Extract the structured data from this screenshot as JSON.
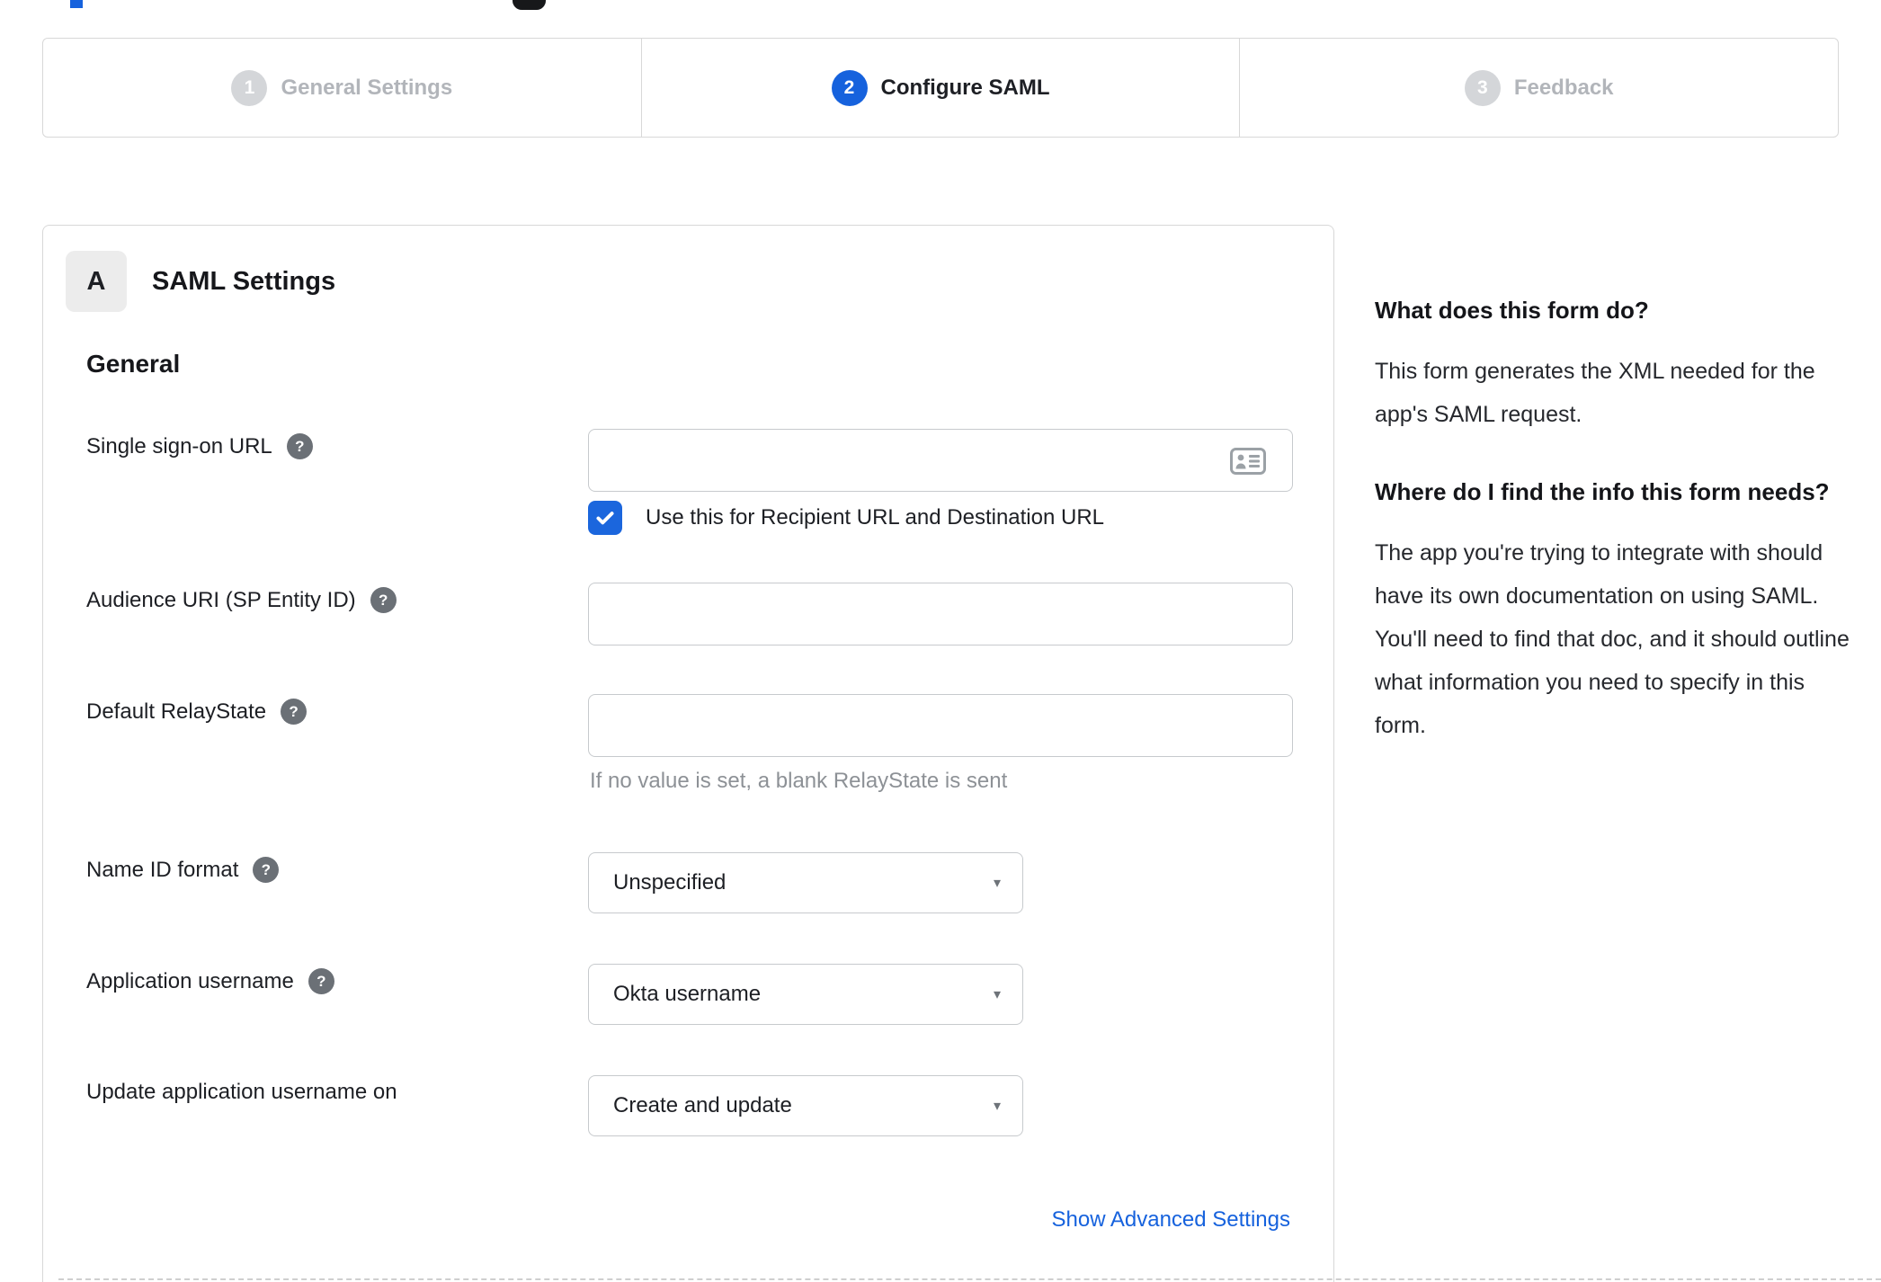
{
  "colors": {
    "accent_blue": "#1662dd",
    "checkbox_blue": "#1b66dd",
    "inactive_gray": "#b2b5ba",
    "border_gray": "#d8d8d8"
  },
  "stepper": {
    "steps": [
      {
        "number": "1",
        "label": "General Settings",
        "state": "inactive"
      },
      {
        "number": "2",
        "label": "Configure SAML",
        "state": "active"
      },
      {
        "number": "3",
        "label": "Feedback",
        "state": "inactive"
      }
    ]
  },
  "panel": {
    "section_badge": "A",
    "section_title": "SAML Settings",
    "group_title": "General",
    "form": {
      "sso": {
        "label": "Single sign-on URL",
        "value": "",
        "checkbox_label": "Use this for Recipient URL and Destination URL",
        "checkbox_checked": true
      },
      "audience": {
        "label": "Audience URI (SP Entity ID)",
        "value": ""
      },
      "relay": {
        "label": "Default RelayState",
        "value": "",
        "hint": "If no value is set, a blank RelayState is sent"
      },
      "nameid": {
        "label": "Name ID format",
        "value": "Unspecified"
      },
      "appuser": {
        "label": "Application username",
        "value": "Okta username"
      },
      "updateuser": {
        "label": "Update application username on",
        "value": "Create and update"
      },
      "advanced_link": "Show Advanced Settings"
    }
  },
  "sidebar": {
    "q1": "What does this form do?",
    "a1": "This form generates the XML needed for the app's SAML request.",
    "q2": "Where do I find the info this form needs?",
    "a2": "The app you're trying to integrate with should have its own documentation on using SAML. You'll need to find that doc, and it should outline what information you need to specify in this form."
  }
}
